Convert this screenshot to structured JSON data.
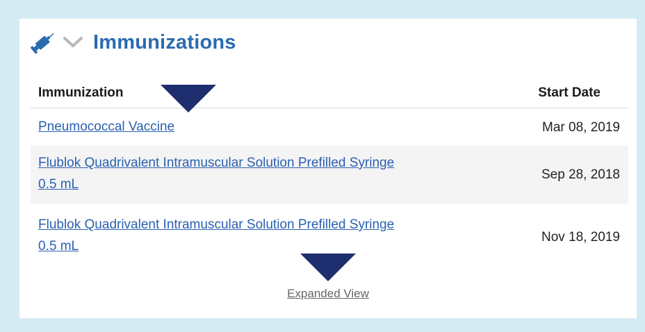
{
  "section": {
    "title": "Immunizations",
    "icons": {
      "section_icon": "syringe-icon",
      "toggle_icon": "chevron-down-icon"
    },
    "accent_color": "#2a6bb0"
  },
  "table": {
    "columns": [
      "Immunization",
      "Start Date"
    ],
    "rows": [
      {
        "name": "Pneumococcal Vaccine",
        "start_date": "Mar 08, 2019"
      },
      {
        "name_line1": "Flublok Quadrivalent Intramuscular Solution Prefilled Syringe",
        "name_line2": "0.5 mL",
        "start_date": "Sep 28, 2018"
      },
      {
        "name_line1": "Flublok Quadrivalent Intramuscular Solution Prefilled Syringe",
        "name_line2": "0.5 mL",
        "start_date": "Nov 18, 2019"
      }
    ]
  },
  "footer": {
    "expanded_view_label": "Expanded View"
  }
}
